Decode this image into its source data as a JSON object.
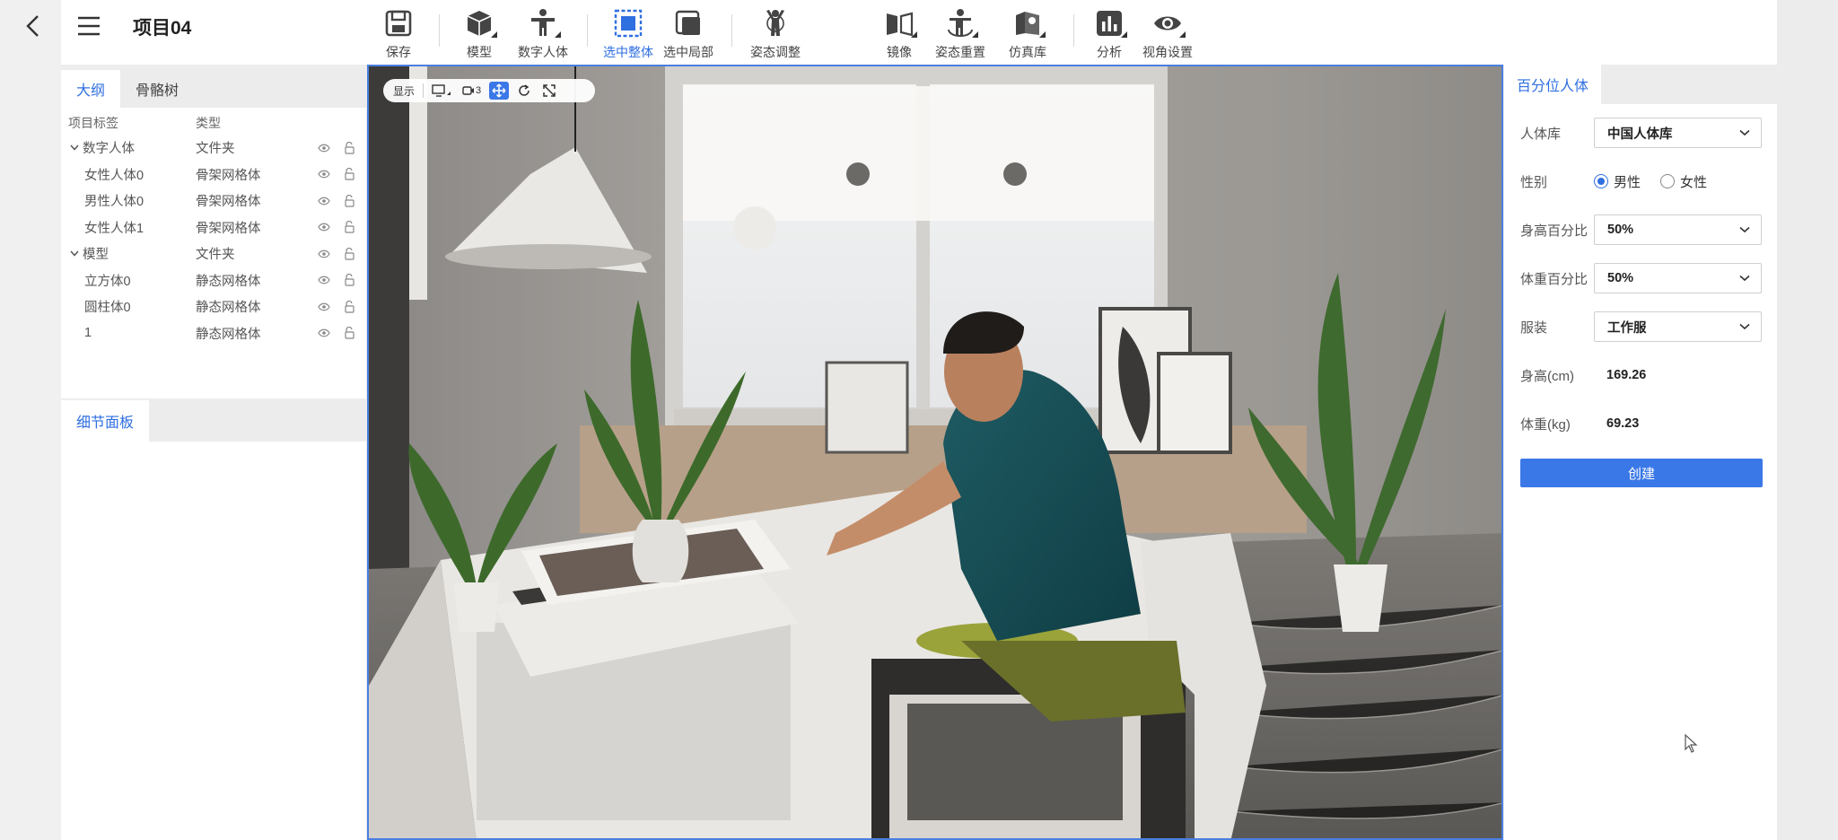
{
  "project": {
    "title": "项目04"
  },
  "toolbar": {
    "save": "保存",
    "model": "模型",
    "digital_human": "数字人体",
    "select_whole": "选中整体",
    "select_part": "选中局部",
    "pose_adjust": "姿态调整",
    "mirror": "镜像",
    "pose_reset": "姿态重置",
    "sim_library": "仿真库",
    "analysis": "分析",
    "view_settings": "视角设置"
  },
  "outline": {
    "tabs": [
      "大纲",
      "骨骼树"
    ],
    "headers": {
      "label": "项目标签",
      "type": "类型"
    },
    "rows": [
      {
        "name": "数字人体",
        "type": "文件夹"
      },
      {
        "name": "女性人体0",
        "type": "骨架网格体"
      },
      {
        "name": "男性人体0",
        "type": "骨架网格体"
      },
      {
        "name": "女性人体1",
        "type": "骨架网格体"
      },
      {
        "name": "模型",
        "type": "文件夹"
      },
      {
        "name": "立方体0",
        "type": "静态网格体"
      },
      {
        "name": "圆柱体0",
        "type": "静态网格体"
      },
      {
        "name": "1",
        "type": "静态网格体"
      }
    ]
  },
  "details": {
    "tab": "细节面板"
  },
  "viewport": {
    "display_label": "显示",
    "camera_label": "3"
  },
  "percentile": {
    "tab": "百分位人体",
    "library_label": "人体库",
    "library_value": "中国人体库",
    "gender_label": "性别",
    "gender_male": "男性",
    "gender_female": "女性",
    "height_pct_label": "身高百分比",
    "height_pct_value": "50%",
    "weight_pct_label": "体重百分比",
    "weight_pct_value": "50%",
    "clothing_label": "服装",
    "clothing_value": "工作服",
    "height_label": "身高(cm)",
    "height_value": "169.26",
    "weight_label": "体重(kg)",
    "weight_value": "69.23",
    "create_label": "创建"
  },
  "colors": {
    "accent": "#2f6fe0",
    "button": "#3b78e7"
  }
}
